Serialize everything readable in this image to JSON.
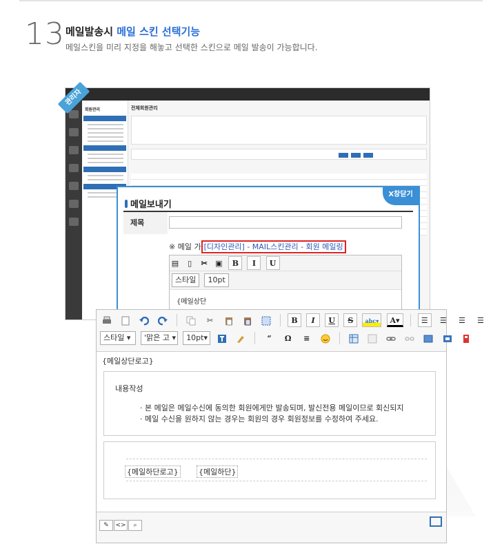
{
  "header": {
    "number": "13",
    "title_plain": "메일발송시",
    "title_highlight": "메일 스킨 선택기능",
    "subtitle": "메일스킨을 미리 지정을 해놓고 선택한 스킨으로 메일 발송이 가능합니다."
  },
  "admin": {
    "badge": "관리자",
    "page_title": "전체회원관리",
    "side_title": "회원관리"
  },
  "popup": {
    "title": "메일보내기",
    "close_label": "X창닫기",
    "subject_label": "제목",
    "note_prefix": "※ 메일 ",
    "note_truncated": "가",
    "note_selected": "[디자인관리] - MAIL스킨관리 - 회원 메일링",
    "editor_style": "스타일",
    "editor_size": "10pt",
    "editor_body": "{메일상단"
  },
  "editor": {
    "style_dropdown": "스타일",
    "font_dropdown": "'맑은 고",
    "size_dropdown": "10pt",
    "top_logo": "{메일상단로고}",
    "content_title": "내용작성",
    "line1": "· 본 메일은 메일수신에 동의한 회원에게만 발송되며, 발신전용 메일이므로 회신되지",
    "line2": "· 메일 수신을 원하지 않는 경우는 회원의 경우 회원정보를 수정하여 주세요.",
    "footer_logo": "{메일하단로고}",
    "footer": "{메일하단}"
  },
  "colors": {
    "accent": "#2a6fd6",
    "highlight_border": "#e02020",
    "close_bg": "#3a8fd6"
  }
}
